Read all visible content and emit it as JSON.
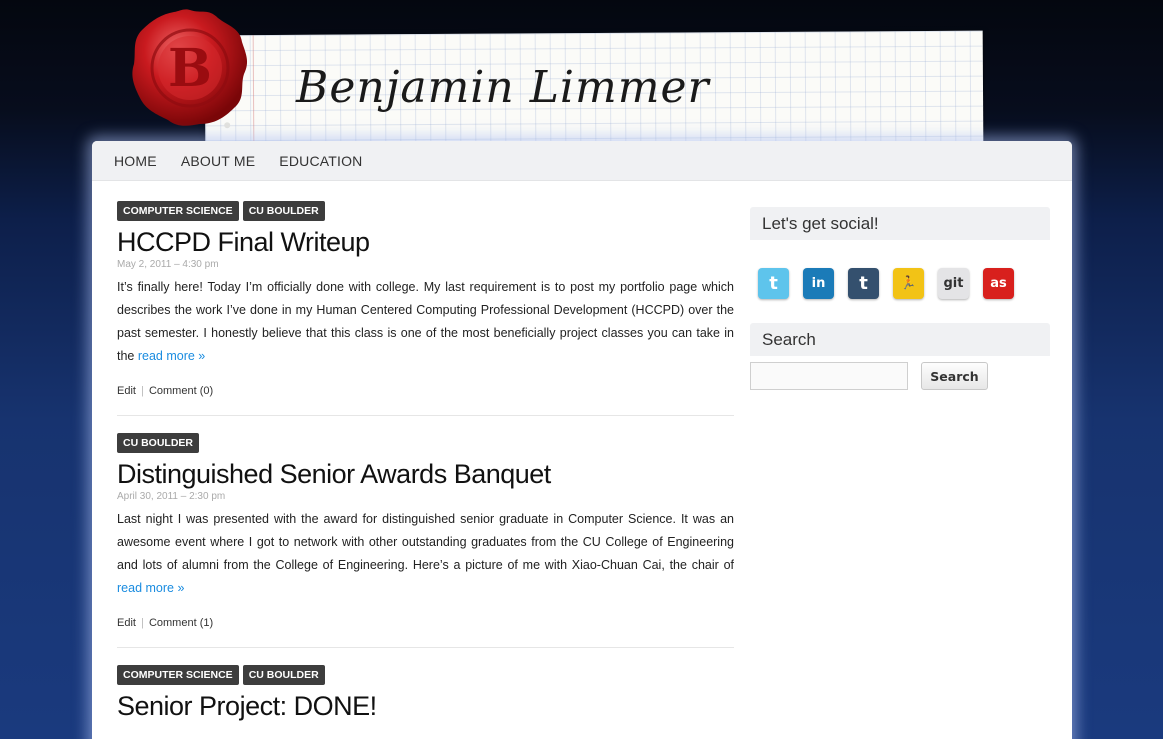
{
  "site": {
    "title": "Benjamin Limmer",
    "seal_letter": "B"
  },
  "nav": [
    {
      "label": "HOME"
    },
    {
      "label": "ABOUT ME"
    },
    {
      "label": "EDUCATION"
    }
  ],
  "posts": [
    {
      "tags": [
        "COMPUTER SCIENCE",
        "CU BOULDER"
      ],
      "title": "HCCPD Final Writeup",
      "date": "May 2, 2011 – 4:30 pm",
      "body": "It’s finally here! Today I’m officially done with college. My last requirement is to post my portfolio page which describes the work I’ve done in my Human Centered Computing Professional Development (HCCPD) over the past semester. I honestly believe that this class is one of the most beneficially project classes you can take in the ",
      "read_more": "read more »",
      "edit": "Edit",
      "separator": "|",
      "comments": "Comment (0)"
    },
    {
      "tags": [
        "CU BOULDER"
      ],
      "title": "Distinguished Senior Awards Banquet",
      "date": "April 30, 2011 – 2:30 pm",
      "body": "Last night I was presented with the award for distinguished senior graduate in Computer Science. It was an awesome event where I got to network with other outstanding graduates from the CU College of Engineering and lots of alumni from the College of Engineering. Here’s a picture of me with Xiao-Chuan Cai, the chair of ",
      "read_more": "read more »",
      "edit": "Edit",
      "separator": "|",
      "comments": "Comment (1)"
    },
    {
      "tags": [
        "COMPUTER SCIENCE",
        "CU BOULDER"
      ],
      "title": "Senior Project: DONE!"
    }
  ],
  "sidebar": {
    "social_title": "Let's get social!",
    "social_icons": [
      {
        "name": "twitter-icon",
        "glyph": "t",
        "color": "#5ec4ec"
      },
      {
        "name": "linkedin-icon",
        "glyph": "in",
        "color": "#1b7bb8"
      },
      {
        "name": "tumblr-icon",
        "glyph": "t",
        "color": "#34506e"
      },
      {
        "name": "aim-icon",
        "glyph": "🏃",
        "color": "#f2c316"
      },
      {
        "name": "github-icon",
        "glyph": "git",
        "color": "#e4e4e6"
      },
      {
        "name": "lastfm-icon",
        "glyph": "as",
        "color": "#d8201d"
      }
    ],
    "search_title": "Search",
    "search_placeholder": "",
    "search_button": "Search"
  }
}
